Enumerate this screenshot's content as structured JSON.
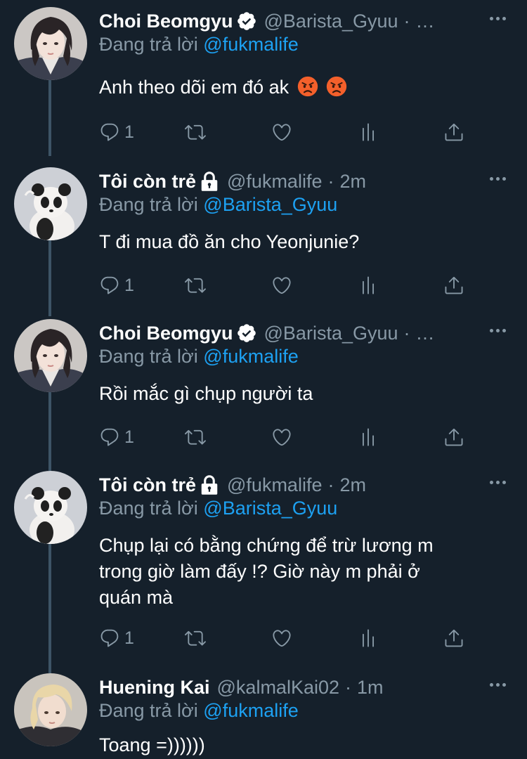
{
  "tweets": [
    {
      "avatar": "avatar-beomgyu",
      "name": "Choi Beomgyu",
      "badge": "verified",
      "handle": "@Barista_Gyuu",
      "time": "…",
      "reply_prefix": "Đang trả lời",
      "reply_to": "@fukmalife",
      "text": "Anh theo dõi em đó ak",
      "emojis": [
        "angry-face",
        "angry-face"
      ],
      "replies": "1"
    },
    {
      "avatar": "avatar-panda",
      "name": "Tôi còn trẻ",
      "badge": "lock",
      "handle": "@fukmalife",
      "time": "2m",
      "reply_prefix": "Đang trả lời",
      "reply_to": "@Barista_Gyuu",
      "text": "T đi mua đồ ăn cho Yeonjunie?",
      "emojis": [],
      "replies": "1"
    },
    {
      "avatar": "avatar-beomgyu",
      "name": "Choi Beomgyu",
      "badge": "verified",
      "handle": "@Barista_Gyuu",
      "time": "…",
      "reply_prefix": "Đang trả lời",
      "reply_to": "@fukmalife",
      "text": "Rồi mắc gì chụp người ta",
      "emojis": [],
      "replies": "1"
    },
    {
      "avatar": "avatar-panda",
      "name": "Tôi còn trẻ",
      "badge": "lock",
      "handle": "@fukmalife",
      "time": "2m",
      "reply_prefix": "Đang trả lời",
      "reply_to": "@Barista_Gyuu",
      "text_lines": [
        "Chụp lại có bằng chứng để trừ lương m",
        "trong giờ làm đấy !? Giờ này m phải ở",
        "quán mà"
      ],
      "emojis": [],
      "replies": "1"
    },
    {
      "avatar": "avatar-huening",
      "name": "Huening Kai",
      "badge": "",
      "handle": "@kalmalKai02",
      "time": "1m",
      "reply_prefix": "Đang trả lời",
      "reply_to": "@fukmalife",
      "text": "Toang =))))))",
      "emojis": [],
      "replies": ""
    }
  ],
  "separator": "·",
  "colors": {
    "background": "#15202b",
    "text": "#ffffff",
    "muted": "#8899a6",
    "link": "#1da1f2",
    "thread_line": "#3d5466"
  }
}
